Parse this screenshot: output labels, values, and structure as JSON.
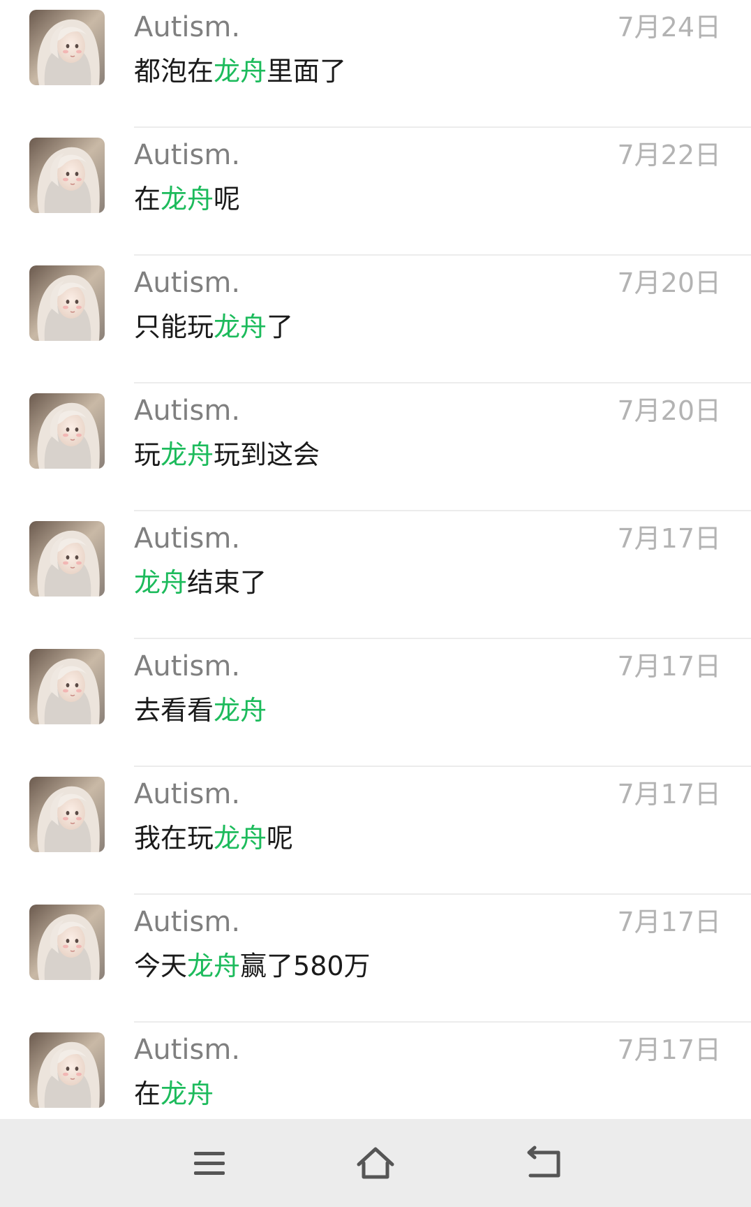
{
  "conversation": {
    "messages": [
      {
        "sender": "Autism.",
        "date": "7月24日",
        "parts": [
          {
            "text": "都泡在",
            "hl": false
          },
          {
            "text": "龙舟",
            "hl": true
          },
          {
            "text": "里面了",
            "hl": false
          }
        ]
      },
      {
        "sender": "Autism.",
        "date": "7月22日",
        "parts": [
          {
            "text": "在",
            "hl": false
          },
          {
            "text": "龙舟",
            "hl": true
          },
          {
            "text": "呢",
            "hl": false
          }
        ]
      },
      {
        "sender": "Autism.",
        "date": "7月20日",
        "parts": [
          {
            "text": "只能玩",
            "hl": false
          },
          {
            "text": "龙舟",
            "hl": true
          },
          {
            "text": "了",
            "hl": false
          }
        ]
      },
      {
        "sender": "Autism.",
        "date": "7月20日",
        "parts": [
          {
            "text": "玩",
            "hl": false
          },
          {
            "text": "龙舟",
            "hl": true
          },
          {
            "text": "玩到这会",
            "hl": false
          }
        ]
      },
      {
        "sender": "Autism.",
        "date": "7月17日",
        "parts": [
          {
            "text": "龙舟",
            "hl": true
          },
          {
            "text": "结束了",
            "hl": false
          }
        ]
      },
      {
        "sender": "Autism.",
        "date": "7月17日",
        "parts": [
          {
            "text": "去看看",
            "hl": false
          },
          {
            "text": "龙舟",
            "hl": true
          }
        ]
      },
      {
        "sender": "Autism.",
        "date": "7月17日",
        "parts": [
          {
            "text": "我在玩",
            "hl": false
          },
          {
            "text": "龙舟",
            "hl": true
          },
          {
            "text": "呢",
            "hl": false
          }
        ]
      },
      {
        "sender": "Autism.",
        "date": "7月17日",
        "parts": [
          {
            "text": "今天",
            "hl": false
          },
          {
            "text": "龙舟",
            "hl": true
          },
          {
            "text": "赢了580万",
            "hl": false
          }
        ]
      },
      {
        "sender": "Autism.",
        "date": "7月17日",
        "parts": [
          {
            "text": "在",
            "hl": false
          },
          {
            "text": "龙舟",
            "hl": true
          }
        ]
      }
    ]
  },
  "navbar": {
    "buttons": [
      {
        "icon": "menu-icon"
      },
      {
        "icon": "home-icon"
      },
      {
        "icon": "back-icon"
      }
    ]
  },
  "colors": {
    "highlight": "#1dbb5c",
    "sender": "#7f7f7f",
    "date": "#b3b3b3",
    "message": "#1a1a1a",
    "navbar_bg": "#ececec",
    "nav_icon": "#555555"
  }
}
